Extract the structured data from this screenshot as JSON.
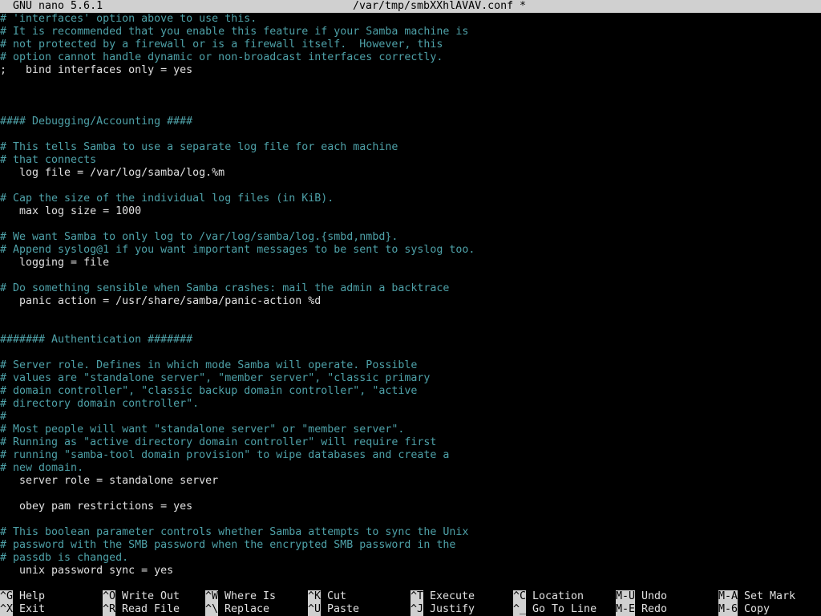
{
  "titlebar": {
    "app": "GNU nano 5.6.1",
    "file": "/var/tmp/smbXXhlAVAV.conf",
    "modified": "*"
  },
  "editor": {
    "lines": [
      {
        "text": "# 'interfaces' option above to use this.",
        "type": "comment"
      },
      {
        "text": "# It is recommended that you enable this feature if your Samba machine is",
        "type": "comment"
      },
      {
        "text": "# not protected by a firewall or is a firewall itself.  However, this",
        "type": "comment"
      },
      {
        "text": "# option cannot handle dynamic or non-broadcast interfaces correctly.",
        "type": "comment"
      },
      {
        "text": ";   bind interfaces only = yes",
        "type": "setting"
      },
      {
        "text": "",
        "type": "setting"
      },
      {
        "text": "",
        "type": "setting"
      },
      {
        "text": "",
        "type": "setting"
      },
      {
        "text": "#### Debugging/Accounting ####",
        "type": "comment"
      },
      {
        "text": "",
        "type": "setting"
      },
      {
        "text": "# This tells Samba to use a separate log file for each machine",
        "type": "comment"
      },
      {
        "text": "# that connects",
        "type": "comment"
      },
      {
        "text": "   log file = /var/log/samba/log.%m",
        "type": "setting"
      },
      {
        "text": "",
        "type": "setting"
      },
      {
        "text": "# Cap the size of the individual log files (in KiB).",
        "type": "comment"
      },
      {
        "text": "   max log size = 1000",
        "type": "setting"
      },
      {
        "text": "",
        "type": "setting"
      },
      {
        "text": "# We want Samba to only log to /var/log/samba/log.{smbd,nmbd}.",
        "type": "comment"
      },
      {
        "text": "# Append syslog@1 if you want important messages to be sent to syslog too.",
        "type": "comment"
      },
      {
        "text": "   logging = file",
        "type": "setting"
      },
      {
        "text": "",
        "type": "setting"
      },
      {
        "text": "# Do something sensible when Samba crashes: mail the admin a backtrace",
        "type": "comment"
      },
      {
        "text": "   panic action = /usr/share/samba/panic-action %d",
        "type": "setting"
      },
      {
        "text": "",
        "type": "setting"
      },
      {
        "text": "",
        "type": "setting"
      },
      {
        "text": "####### Authentication #######",
        "type": "comment"
      },
      {
        "text": "",
        "type": "setting"
      },
      {
        "text": "# Server role. Defines in which mode Samba will operate. Possible",
        "type": "comment"
      },
      {
        "text": "# values are \"standalone server\", \"member server\", \"classic primary",
        "type": "comment"
      },
      {
        "text": "# domain controller\", \"classic backup domain controller\", \"active",
        "type": "comment"
      },
      {
        "text": "# directory domain controller\".",
        "type": "comment"
      },
      {
        "text": "#",
        "type": "comment"
      },
      {
        "text": "# Most people will want \"standalone server\" or \"member server\".",
        "type": "comment"
      },
      {
        "text": "# Running as \"active directory domain controller\" will require first",
        "type": "comment"
      },
      {
        "text": "# running \"samba-tool domain provision\" to wipe databases and create a",
        "type": "comment"
      },
      {
        "text": "# new domain.",
        "type": "comment"
      },
      {
        "text": "   server role = standalone server",
        "type": "setting"
      },
      {
        "text": "",
        "type": "setting"
      },
      {
        "text": "   obey pam restrictions = yes",
        "type": "setting"
      },
      {
        "text": "",
        "type": "setting"
      },
      {
        "text": "# This boolean parameter controls whether Samba attempts to sync the Unix",
        "type": "comment"
      },
      {
        "text": "# password with the SMB password when the encrypted SMB password in the",
        "type": "comment"
      },
      {
        "text": "# passdb is changed.",
        "type": "comment"
      },
      {
        "text": "   unix password sync = yes",
        "type": "setting"
      }
    ]
  },
  "shortcuts": [
    {
      "key": "^G",
      "label": "Help"
    },
    {
      "key": "^X",
      "label": "Exit"
    },
    {
      "key": "^O",
      "label": "Write Out"
    },
    {
      "key": "^R",
      "label": "Read File"
    },
    {
      "key": "^W",
      "label": "Where Is"
    },
    {
      "key": "^\\",
      "label": "Replace"
    },
    {
      "key": "^K",
      "label": "Cut"
    },
    {
      "key": "^U",
      "label": "Paste"
    },
    {
      "key": "^T",
      "label": "Execute"
    },
    {
      "key": "^J",
      "label": "Justify"
    },
    {
      "key": "^C",
      "label": "Location"
    },
    {
      "key": "^_",
      "label": "Go To Line"
    },
    {
      "key": "M-U",
      "label": "Undo"
    },
    {
      "key": "M-E",
      "label": "Redo"
    },
    {
      "key": "M-A",
      "label": "Set Mark"
    },
    {
      "key": "M-6",
      "label": "Copy"
    }
  ],
  "colors": {
    "background": "#000000",
    "comment": "#4ea1a8",
    "text": "#e0e0e0",
    "titlebar_bg": "#d0d0d0"
  }
}
